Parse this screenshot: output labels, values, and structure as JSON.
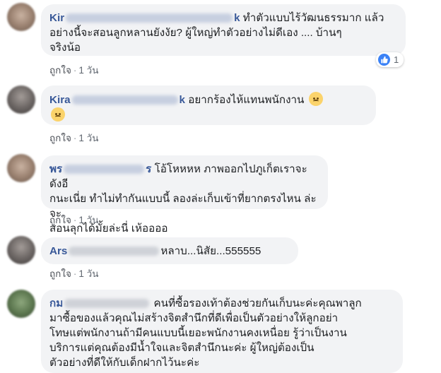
{
  "comments": [
    {
      "author_visible": "Kir",
      "author_tail": "k",
      "text_lines": [
        "ทำตัวแบบไร้วัฒนธรรมาก แล้ว",
        "อย่างนี้จะสอนลูกหลานยังงัย? ผู้ใหญ่ทำตัวอย่างไม่ดีเอง .... บ้านๆ",
        "จริงน้อ"
      ],
      "like_label": "ถูกใจ",
      "time": "1 วัน",
      "reaction_count": "1"
    },
    {
      "author_visible": "Kira",
      "author_tail": "k",
      "text_lines": [
        "อยากร้องไห้แทนพนักงาน"
      ],
      "emoji": "sad-face",
      "like_label": "ถูกใจ",
      "time": "1 วัน"
    },
    {
      "author_visible": "พร",
      "author_tail": "ร",
      "text_lines": [
        "โอ้โหหหห ภาพออกไปภูเก็ตเราจะดังอี",
        "กนะเนี่ย ทำไม่ทำกันแบบนี้ ลองล่ะเก็บเข้าที่ยากตรงไหน ล่ะจะ",
        "สอนลุกได้มั้ยล่ะนี่ เห้ออออ"
      ],
      "like_label": "ถูกใจ",
      "time": "1 วัน"
    },
    {
      "author_visible": "Ars",
      "text_lines": [
        "หลาบ...นิสัย...555555"
      ],
      "like_label": "ถูกใจ",
      "time": "1 วัน"
    },
    {
      "author_visible": "กม",
      "text_lines": [
        "คนที่ซื้อรองเท้าต้องช่วยกันเก็บนะค่ะคุณพาลูก",
        "มาซื้อของแล้วคุณไม่สร้างจิตสำนึกที่ดีเพื่อเป็นตัวอย่างให้ลูกอย่า",
        "โทษแต่พนักงานถ้ามีคนแบบนี้เยอะพนักงานคงเหนื่อย รู้ว่าเป็นงาน",
        "บริการแต่คุณต้องมีน้ำใจและจิตสำนึกนะค่ะ ผู้ใหญ่ต้องเป็น",
        "ตัวอย่างที่ดีให้กับเด็กฝากไว้นะค่ะ"
      ]
    }
  ],
  "colors": {
    "author": "#385898",
    "bubble": "#f2f3f5",
    "like_badge": "#3b82f6"
  }
}
